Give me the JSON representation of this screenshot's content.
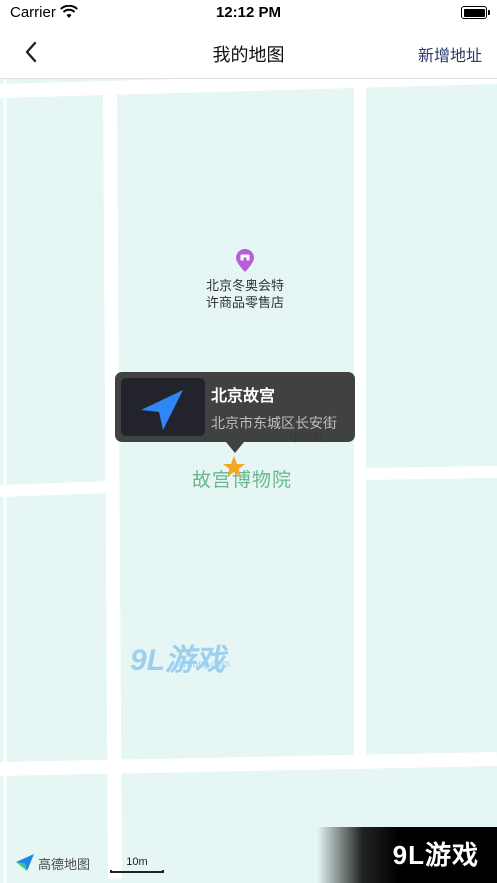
{
  "status": {
    "carrier": "Carrier",
    "time": "12:12 PM"
  },
  "navbar": {
    "title": "我的地图",
    "add_label": "新增地址"
  },
  "map": {
    "poi": {
      "line1": "北京冬奥会特",
      "line2": "许商品零售店"
    },
    "callout": {
      "name": "北京故宫",
      "address": "北京市东城区长安街"
    },
    "museum_label": "故宫博物院",
    "museum_small_label": "中和殿",
    "watermark_mid": {
      "big": "9L游戏",
      "small": "91danji.com"
    },
    "logo_text": "高德地图",
    "scale_text": "10m",
    "watermark_corner": "9L游戏"
  },
  "colors": {
    "map_bg": "#e6f6f4",
    "road": "#ffffff",
    "accent": "#2b3a6b",
    "nav_arrow": "#2f86f5",
    "star": "#f5a623",
    "poi_pin": "#b85dd6"
  }
}
